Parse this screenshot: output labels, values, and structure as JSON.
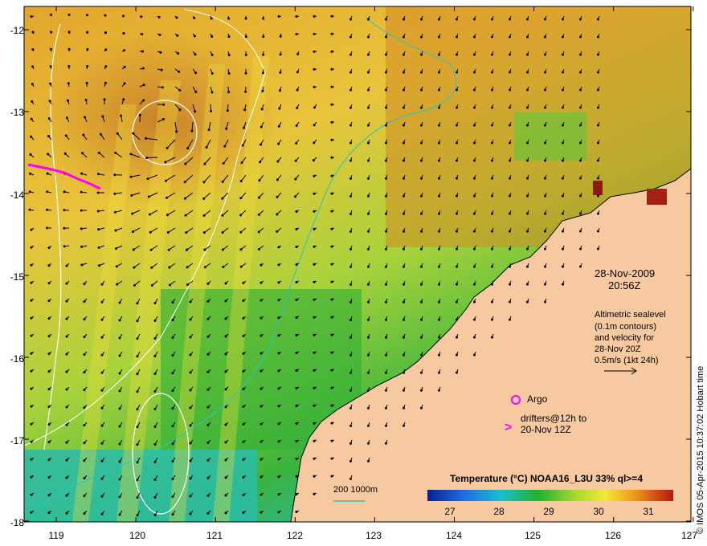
{
  "map": {
    "date_line1": "28-Nov-2009",
    "date_line2": "20:56Z",
    "altimetry_text": [
      "Altimetric sealevel",
      "(0.1m contours)",
      "and velocity for",
      "28-Nov 20Z",
      "0.5m/s (1kt 24h)"
    ],
    "argo_label": "Argo",
    "drifter_label": [
      "drifters@12h to",
      "20-Nov 12Z"
    ],
    "drifter_symbol": ">",
    "bathymetry_label": "200  1000m",
    "colorbar_title": "Temperature (°C) NOAA16_L3U 33% ql>=4",
    "colorbar_ticks": [
      "27",
      "28",
      "29",
      "30",
      "31"
    ],
    "credit": "© IMOS 05-Apr-2015 10:37:02 Hobart time",
    "lat_ticks": [
      "-12",
      "-13",
      "-14",
      "-15",
      "-16",
      "-17",
      "-18"
    ],
    "lon_ticks": [
      "119",
      "120",
      "121",
      "122",
      "123",
      "124",
      "125",
      "126",
      "127"
    ],
    "colors": {
      "land": "#f7c9a1",
      "coast": "#000000",
      "bathy_200": "#22c8c8",
      "bathy_1000": "#ffffff",
      "argo": "#ff00ff",
      "drifter": "#ff00ff",
      "warm": "#d07a1a",
      "cool": "#3cb43c"
    }
  }
}
